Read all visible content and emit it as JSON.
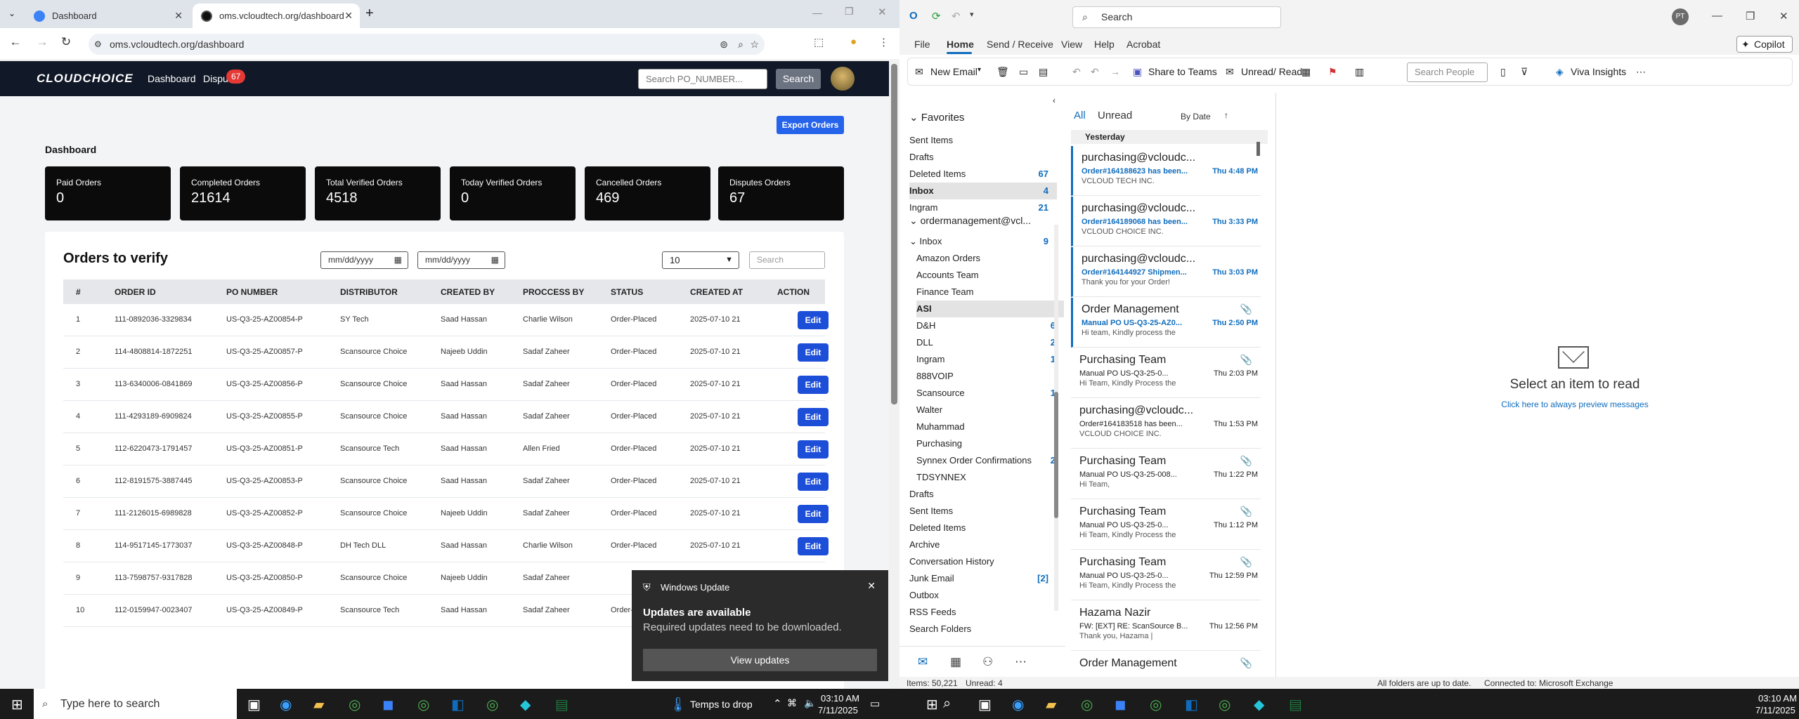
{
  "browser": {
    "tabs": [
      {
        "title": "Dashboard",
        "active": false
      },
      {
        "title": "oms.vcloudtech.org/dashboard",
        "active": true
      }
    ],
    "url": "oms.vcloudtech.org/dashboard"
  },
  "site": {
    "logo": "CLOUDCHOICE",
    "nav": {
      "dashboard": "Dashboard",
      "disputes": "Dispu",
      "disputes_badge": "67"
    },
    "search_placeholder": "Search PO_NUMBER...",
    "search_button": "Search",
    "export_button": "Export Orders",
    "dashboard_title": "Dashboard",
    "stats": [
      {
        "label": "Paid Orders",
        "value": "0"
      },
      {
        "label": "Completed Orders",
        "value": "21614"
      },
      {
        "label": "Total Verified Orders",
        "value": "4518"
      },
      {
        "label": "Today Verified Orders",
        "value": "0"
      },
      {
        "label": "Cancelled Orders",
        "value": "469"
      },
      {
        "label": "Disputes Orders",
        "value": "67"
      }
    ],
    "orders_title": "Orders to verify",
    "date_from": "mm/dd/yyyy",
    "date_to": "mm/dd/yyyy",
    "page_size": "10",
    "table_search_placeholder": "Search",
    "columns": [
      "#",
      "ORDER ID",
      "PO NUMBER",
      "DISTRIBUTOR",
      "CREATED BY",
      "PROCCESS BY",
      "STATUS",
      "CREATED AT",
      "ACTION"
    ],
    "rows": [
      [
        "1",
        "111-0892036-3329834",
        "US-Q3-25-AZ00854-P",
        "SY Tech",
        "Saad Hassan",
        "Charlie Wilson",
        "Order-Placed",
        "2025-07-10 21",
        "Edit"
      ],
      [
        "2",
        "114-4808814-1872251",
        "US-Q3-25-AZ00857-P",
        "Scansource Choice",
        "Najeeb Uddin",
        "Sadaf Zaheer",
        "Order-Placed",
        "2025-07-10 21",
        "Edit"
      ],
      [
        "3",
        "113-6340006-0841869",
        "US-Q3-25-AZ00856-P",
        "Scansource Choice",
        "Saad Hassan",
        "Sadaf Zaheer",
        "Order-Placed",
        "2025-07-10 21",
        "Edit"
      ],
      [
        "4",
        "111-4293189-6909824",
        "US-Q3-25-AZ00855-P",
        "Scansource Choice",
        "Saad Hassan",
        "Sadaf Zaheer",
        "Order-Placed",
        "2025-07-10 21",
        "Edit"
      ],
      [
        "5",
        "112-6220473-1791457",
        "US-Q3-25-AZ00851-P",
        "Scansource Tech",
        "Saad Hassan",
        "Allen Fried",
        "Order-Placed",
        "2025-07-10 21",
        "Edit"
      ],
      [
        "6",
        "112-8191575-3887445",
        "US-Q3-25-AZ00853-P",
        "Scansource Choice",
        "Saad Hassan",
        "Sadaf Zaheer",
        "Order-Placed",
        "2025-07-10 21",
        "Edit"
      ],
      [
        "7",
        "111-2126015-6989828",
        "US-Q3-25-AZ00852-P",
        "Scansource Choice",
        "Najeeb Uddin",
        "Sadaf Zaheer",
        "Order-Placed",
        "2025-07-10 21",
        "Edit"
      ],
      [
        "8",
        "114-9517145-1773037",
        "US-Q3-25-AZ00848-P",
        "DH Tech DLL",
        "Saad Hassan",
        "Charlie Wilson",
        "Order-Placed",
        "2025-07-10 21",
        "Edit"
      ],
      [
        "9",
        "113-7598757-9317828",
        "US-Q3-25-AZ00850-P",
        "Scansource Choice",
        "Najeeb Uddin",
        "Sadaf Zaheer",
        "",
        "",
        ""
      ],
      [
        "10",
        "112-0159947-0023407",
        "US-Q3-25-AZ00849-P",
        "Scansource Tech",
        "Saad Hassan",
        "Sadaf Zaheer",
        "Order-",
        "",
        ""
      ]
    ]
  },
  "toast": {
    "app": "Windows Update",
    "title": "Updates are available",
    "body": "Required updates need to be downloaded.",
    "button": "View updates"
  },
  "outlook": {
    "search": "Search",
    "avatar": "PT",
    "menu": [
      "File",
      "Home",
      "Send / Receive",
      "View",
      "Help",
      "Acrobat"
    ],
    "copilot": "Copilot",
    "ribbon": {
      "new_email": "New Email",
      "share_teams": "Share to Teams",
      "unread_read": "Unread/ Read",
      "search_people": "Search People",
      "viva": "Viva Insights"
    },
    "favorites_header": "Favorites",
    "favorites": [
      {
        "name": "Sent Items",
        "count": ""
      },
      {
        "name": "Drafts",
        "count": ""
      },
      {
        "name": "Deleted Items",
        "count": "67"
      },
      {
        "name": "Inbox",
        "count": "4"
      },
      {
        "name": "Ingram",
        "count": "21"
      }
    ],
    "account": "ordermanagement@vcl...",
    "inbox": {
      "name": "Inbox",
      "count": "9"
    },
    "inbox_sub": [
      {
        "name": "Amazon Orders",
        "count": ""
      },
      {
        "name": "Accounts Team",
        "count": ""
      },
      {
        "name": "Finance Team",
        "count": ""
      },
      {
        "name": "ASI",
        "count": ""
      },
      {
        "name": "D&H",
        "count": "6"
      },
      {
        "name": "DLL",
        "count": "2"
      },
      {
        "name": "Ingram",
        "count": "1"
      },
      {
        "name": "888VOIP",
        "count": ""
      },
      {
        "name": "Scansource",
        "count": "1"
      },
      {
        "name": "Walter",
        "count": ""
      },
      {
        "name": "Muhammad",
        "count": ""
      },
      {
        "name": "Purchasing",
        "count": ""
      },
      {
        "name": "Synnex Order Confirmations",
        "count": "2"
      },
      {
        "name": "TDSYNNEX",
        "count": ""
      }
    ],
    "other_folders": [
      {
        "name": "Drafts",
        "count": ""
      },
      {
        "name": "Sent Items",
        "count": ""
      },
      {
        "name": "Deleted Items",
        "count": ""
      },
      {
        "name": "Archive",
        "count": ""
      },
      {
        "name": "Conversation History",
        "count": ""
      },
      {
        "name": "Junk Email",
        "count": "[2]"
      },
      {
        "name": "Outbox",
        "count": ""
      },
      {
        "name": "RSS Feeds",
        "count": ""
      },
      {
        "name": "Search Folders",
        "count": ""
      }
    ],
    "list_tabs": {
      "all": "All",
      "unread": "Unread",
      "sort": "By Date"
    },
    "group": "Yesterday",
    "messages": [
      {
        "from": "purchasing@vcloudc...",
        "subject": "Order#164188623 has been...",
        "date": "Thu 4:48 PM",
        "preview": "VCLOUD TECH INC.",
        "unread": true,
        "clip": false
      },
      {
        "from": "purchasing@vcloudc...",
        "subject": "Order#164189068 has been...",
        "date": "Thu 3:33 PM",
        "preview": "VCLOUD CHOICE INC.",
        "unread": true,
        "clip": false
      },
      {
        "from": "purchasing@vcloudc...",
        "subject": "Order#164144927 Shipmen...",
        "date": "Thu 3:03 PM",
        "preview": "Thank you for your Order!",
        "unread": true,
        "clip": false
      },
      {
        "from": "Order Management",
        "subject": "Manual PO  US-Q3-25-AZ0...",
        "date": "Thu 2:50 PM",
        "preview": "Hi team,  Kindly process the",
        "unread": true,
        "clip": true
      },
      {
        "from": "Purchasing Team",
        "subject": "Manual PO  US-Q3-25-0...",
        "date": "Thu 2:03 PM",
        "preview": "Hi Team,  Kindly Process the",
        "unread": false,
        "clip": true
      },
      {
        "from": "purchasing@vcloudc...",
        "subject": "Order#164183518 has been...",
        "date": "Thu 1:53 PM",
        "preview": "VCLOUD CHOICE INC.",
        "unread": false,
        "clip": false
      },
      {
        "from": "Purchasing Team",
        "subject": "Manual PO  US-Q3-25-008...",
        "date": "Thu 1:22 PM",
        "preview": "Hi Team,",
        "unread": false,
        "clip": true
      },
      {
        "from": "Purchasing Team",
        "subject": "Manual PO  US-Q3-25-0...",
        "date": "Thu 1:12 PM",
        "preview": "Hi Team,  Kindly Process the",
        "unread": false,
        "clip": true
      },
      {
        "from": "Purchasing Team",
        "subject": "Manual PO  US-Q3-25-0...",
        "date": "Thu 12:59 PM",
        "preview": "Hi Team,  Kindly Process the",
        "unread": false,
        "clip": true
      },
      {
        "from": "Hazama Nazir",
        "subject": "FW: [EXT] RE: ScanSource B...",
        "date": "Thu 12:56 PM",
        "preview": "Thank you,  Hazama |",
        "unread": false,
        "clip": false
      },
      {
        "from": "Order Management",
        "subject": "",
        "date": "",
        "preview": "",
        "unread": false,
        "clip": true
      }
    ],
    "reading": {
      "title": "Select an item to read",
      "link": "Click here to always preview messages"
    },
    "status": {
      "items": "Items: 50,221",
      "unread": "Unread: 4",
      "sync": "All folders are up to date.",
      "connected": "Connected to: Microsoft Exchange"
    }
  },
  "taskbar": {
    "search_placeholder": "Type here to search",
    "weather": "Temps to drop",
    "clock_left": {
      "time": "03:10 AM",
      "date": "7/11/2025"
    },
    "clock_right": {
      "time": "03:10 AM",
      "date": "7/11/2025"
    }
  },
  "colors": {
    "accent": "#0f6cbd",
    "site_nav": "#111827",
    "edit_button": "#1d4ed8",
    "stat_card": "#0b0b0b"
  }
}
